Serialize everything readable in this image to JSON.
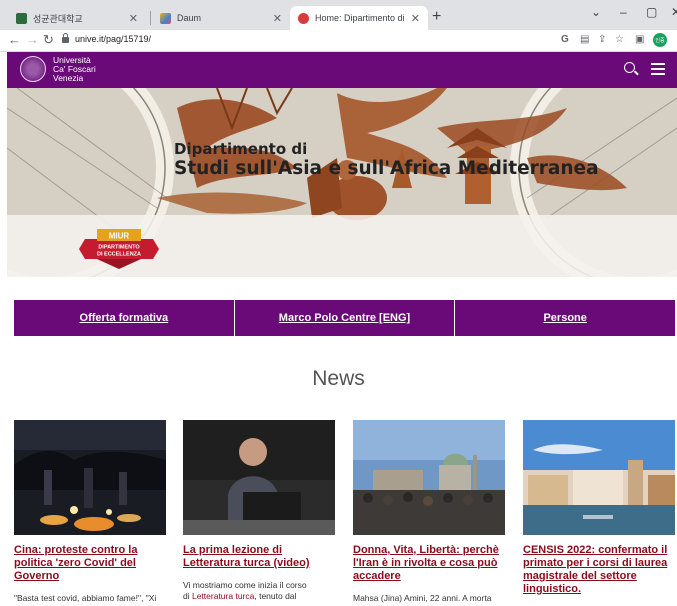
{
  "browser": {
    "tabs": [
      {
        "title": "성균관대학교",
        "active": false
      },
      {
        "title": "Daum",
        "active": false
      },
      {
        "title": "Home: Dipartimento di Studi su",
        "active": true
      }
    ],
    "url": "unive.it/pag/15719/",
    "profile_label": "인증"
  },
  "site": {
    "logo_lines": [
      "Università",
      "Ca' Foscari",
      "Venezia"
    ],
    "miur_badge": {
      "line1": "MIUR",
      "line2": "DIPARTIMENTO",
      "line3": "DI ECCELLENZA"
    },
    "dept_prefix": "Dipartimento di",
    "dept_name": "Studi sull'Asia e sull'Africa Mediterranea"
  },
  "nav": [
    {
      "label": "Offerta formativa"
    },
    {
      "label": "Marco Polo Centre [ENG]"
    },
    {
      "label": "Persone"
    }
  ],
  "news": {
    "title": "News",
    "items": [
      {
        "headline": "Cina: proteste contro la politica 'zero Covid' del Governo",
        "excerpt": "\"Basta test covid, abbiamo fame!\", \"Xi"
      },
      {
        "headline": "La prima lezione di Letteratura turca (video)",
        "excerpt": "Vi mostriamo come inizia il corso",
        "excerpt2_pre": "di ",
        "excerpt2_link": "Letteratura turca",
        "excerpt2_post": ", tenuto dal"
      },
      {
        "headline": "Donna, Vita, Libertà: perchè l'Iran è in rivolta e cosa può accadere",
        "excerpt": "Mahsa (Jina) Amini, 22 anni. A morta"
      },
      {
        "headline": "CENSIS 2022: confermato il primato per i corsi di laurea magistrale del settore linguistico.",
        "excerpt": ""
      }
    ]
  },
  "colors": {
    "brand_purple": "#6a0a78",
    "headline_red": "#8a0a1e"
  }
}
